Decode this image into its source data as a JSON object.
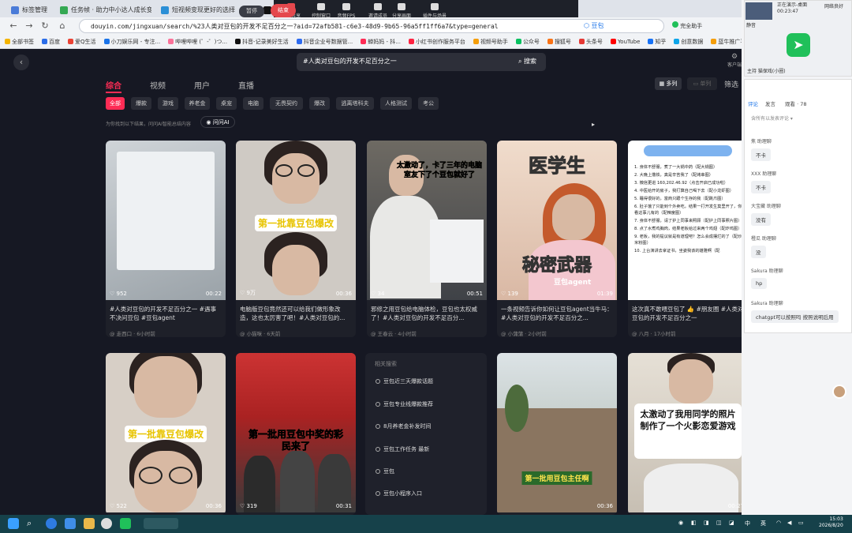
{
  "browser": {
    "tabs": [
      {
        "label": "标签管理",
        "color": "#4a7bd8"
      },
      {
        "label": "任务帧 · 助力中小达人成长变现",
        "color": "#34a853"
      },
      {
        "label": "短视频变现更好的选择",
        "color": "#2b8fd6"
      },
      {
        "label": "抖",
        "color": "#111111"
      }
    ],
    "url": "douyin.com/jingxuan/search/%23人类对豆包的开发不足百分之一?aid=72afb581-c6e3-48d9-9b65-96a5ff1ff6a7&type=general",
    "extension_label": "豆包",
    "profile_label": "完全助手",
    "bookmarks": [
      "全部书签",
      "百度",
      "爱Q生活",
      "小刀娱乐网 - 专注...",
      "哔哩哔哩 (゜-゜)つ...",
      "抖音-记录美好生活",
      "抖音企业号数据管...",
      "蝉妈妈 - 抖...",
      "小红书创作服务平台",
      "视频号助手",
      "公众号",
      "搜狐号",
      "头条号",
      "YouTube",
      "知乎",
      "创意数据",
      "蓝牛推广平台"
    ]
  },
  "meeting_toolbar": {
    "items": [
      "结束共享",
      "控制窗口",
      "音频FPS",
      "邀请成员",
      "分享画面",
      "插件与场景"
    ],
    "pause_label": "暂停",
    "end_label": "结束"
  },
  "search": {
    "query": "#人类对豆包的开发不足百分之一",
    "button": "搜索",
    "settings": "客户端"
  },
  "nav_tabs": [
    "综合",
    "视频",
    "用户",
    "直播"
  ],
  "layout": {
    "multi": "多列",
    "single": "单列",
    "filter": "筛选"
  },
  "chips": [
    "全部",
    "爆款",
    "游戏",
    "养老金",
    "桌宠",
    "电脑",
    "无畏契约",
    "爆改",
    "逃离塔科夫",
    "人格测试",
    "考公"
  ],
  "ai_hint": "为你找到以下结果，问问AI智能总结内容",
  "ai_button": "问问AI",
  "cards_row1": [
    {
      "likes": "952",
      "duration": "00:22",
      "title": "#人类对豆包的开发不足百分之一 #遇事不决问豆包 #豆包agent",
      "author": "@ 走西口",
      "time": "6小时前"
    },
    {
      "likes": "9万",
      "duration": "00:36",
      "title": "电脑版豆包竟然还可以给我们做形象改造，这也太厉害了吧！#人类对豆包的...",
      "author": "@ 小猫咪",
      "time": "6天前",
      "caption": "第一批靠豆包爆改"
    },
    {
      "likes": "34",
      "duration": "00:51",
      "title": "邪修之用豆包给电脑体检，豆包也太权威了！#人类对豆包的开发不足百分...",
      "author": "@ 王春云",
      "time": "4小时前",
      "caption": "太激动了，卡了三年的电脑室友下了个豆包就好了"
    },
    {
      "likes": "139",
      "duration": "01:39",
      "title": "一条视频告诉你如何让豆包agent当牛马：#人类对豆包的开发不足百分之...",
      "author": "@ 小蒲蒲",
      "time": "2小时前",
      "caption_top": "医学生",
      "caption_bottom": "秘密武器",
      "caption_small": "豆包agent"
    },
    {
      "likes": "",
      "duration": "",
      "title": "这次真不敢喂豆包了 👍 #朋友圈 #人类对豆包的开发不足百分之一",
      "author": "@ 八月",
      "time": "17小时前",
      "list": [
        "1. 身体不舒服，煮了一大锅中药（配大锅图）",
        "2. 大晚上撸铁，真是辛苦我了（配烤串图）",
        "3. 微信更进 160,202.46.92（点击开启已成功啦）",
        "4. 中医给开的房子，我打算自己喝下去（配小龙虾图）",
        "5. 睡得很好的，富商只跟个生存的我（配跳爪图）",
        "6. 肚子饿了只能到个外卖吃，结果一打开发生莫里开了，你看这事儿有的（配辣度图）",
        "7. 身体不舒服，请了护上同事来照顾（配护上同事照片图）",
        "8. 点了水煮鸡胸肉，结果老板给过来两个鸡翅（配炸鸡图）",
        "9. 老板，我的提议就是有道理吧？怎么会成摆烂的了（配炒米粉图）",
        "10. 上台演讲去拿证书，坐姿我该的雄雅啊（配"
      ]
    }
  ],
  "cards_row2": [
    {
      "likes": "522",
      "duration": "00:36",
      "caption": "第一批靠豆包爆改"
    },
    {
      "likes": "319",
      "duration": "00:31",
      "caption": "第一批用豆包中奖的彩民来了"
    },
    {
      "likes": "",
      "duration": "00:36",
      "caption": "第一批用豆包主任啊"
    },
    {
      "likes": "",
      "duration": "00:27",
      "caption": "太激动了我用同学的照片制作了一个火影恋爱游戏"
    }
  ],
  "related": {
    "title": "相关搜索",
    "items": [
      "豆包近三天爆款话题",
      "豆包专业线爆款推荐",
      "8月养老金补发时间",
      "豆包工作任务 最新",
      "豆包",
      "豆包小程序入口"
    ]
  },
  "side_panel": {
    "presenter": "正在演示-桌面",
    "presenter_sub": "00:23:47",
    "thumb_caption": "静音",
    "network": "网络良好",
    "host_badge": "主持 猫保戏(小圈)",
    "tabs": [
      "评论",
      "发言",
      "观看 · 78"
    ],
    "filter": "含所有以发表评论 ▾",
    "messages": [
      {
        "name": "焦  助理聊",
        "text": "不卡"
      },
      {
        "name": "XXX  助理聊",
        "text": "不卡"
      },
      {
        "name": "大宝藏  助理聊",
        "text": "没有"
      },
      {
        "name": "橙瓜  助理聊",
        "text": "没"
      },
      {
        "name": "Sakura  助理聊",
        "text": "hp"
      },
      {
        "name": "Sakura  助理聊",
        "text": "chatgpt可以按照吗 按照说明后用"
      }
    ]
  },
  "taskbar": {
    "time": "15:03",
    "date": "2026/8/20",
    "ime": "中",
    "tray_label": "英"
  }
}
